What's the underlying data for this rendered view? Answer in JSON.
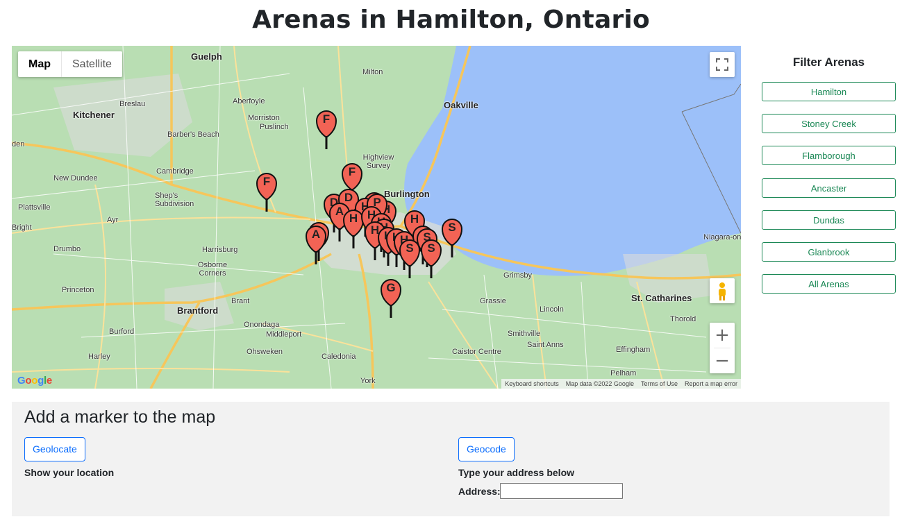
{
  "page": {
    "title": "Arenas in Hamilton, Ontario"
  },
  "map": {
    "type_controls": {
      "map_label": "Map",
      "satellite_label": "Satellite"
    },
    "attribution": {
      "keyboard": "Keyboard shortcuts",
      "data": "Map data ©2022 Google",
      "terms": "Terms of Use",
      "report": "Report a map error"
    },
    "logo": [
      "G",
      "o",
      "o",
      "g",
      "l",
      "e"
    ],
    "places": [
      {
        "name": "Guelph",
        "cls": "city"
      },
      {
        "name": "Kitchener",
        "cls": "city"
      },
      {
        "name": "Oakville",
        "cls": "city"
      },
      {
        "name": "Burlington",
        "cls": "city"
      },
      {
        "name": "Brantford",
        "cls": "city"
      },
      {
        "name": "St. Catharines",
        "cls": "city"
      },
      {
        "name": "Milton",
        "cls": ""
      },
      {
        "name": "Breslau",
        "cls": ""
      },
      {
        "name": "Aberfoyle",
        "cls": ""
      },
      {
        "name": "Morriston",
        "cls": ""
      },
      {
        "name": "Puslinch",
        "cls": ""
      },
      {
        "name": "Barber's Beach",
        "cls": ""
      },
      {
        "name": "Cambridge",
        "cls": ""
      },
      {
        "name": "New Dundee",
        "cls": ""
      },
      {
        "name": "Shep's Subdivision",
        "cls": ""
      },
      {
        "name": "Plattsville",
        "cls": ""
      },
      {
        "name": "Ayr",
        "cls": ""
      },
      {
        "name": "Drumbo",
        "cls": ""
      },
      {
        "name": "Harrisburg",
        "cls": ""
      },
      {
        "name": "Osborne Corners",
        "cls": ""
      },
      {
        "name": "Princeton",
        "cls": ""
      },
      {
        "name": "Brant",
        "cls": ""
      },
      {
        "name": "Burford",
        "cls": ""
      },
      {
        "name": "Onondaga",
        "cls": ""
      },
      {
        "name": "Middleport",
        "cls": ""
      },
      {
        "name": "Ohsweken",
        "cls": ""
      },
      {
        "name": "Caledonia",
        "cls": ""
      },
      {
        "name": "York",
        "cls": ""
      },
      {
        "name": "Harley",
        "cls": ""
      },
      {
        "name": "Grimsby",
        "cls": ""
      },
      {
        "name": "Grassie",
        "cls": ""
      },
      {
        "name": "Lincoln",
        "cls": ""
      },
      {
        "name": "Smithville",
        "cls": ""
      },
      {
        "name": "Saint Anns",
        "cls": ""
      },
      {
        "name": "Caistor Centre",
        "cls": ""
      },
      {
        "name": "Effingham",
        "cls": ""
      },
      {
        "name": "Pelham",
        "cls": ""
      },
      {
        "name": "Thorold",
        "cls": ""
      },
      {
        "name": "Niagara-on",
        "cls": ""
      },
      {
        "name": "Highview Survey",
        "cls": ""
      },
      {
        "name": "Bright",
        "cls": ""
      },
      {
        "name": "den",
        "cls": ""
      }
    ],
    "markers": [
      "F",
      "F",
      "F",
      "D",
      "D",
      "H",
      "H",
      "H",
      "P",
      "A",
      "A",
      "A",
      "H",
      "H",
      "H",
      "H",
      "H",
      "H",
      "H",
      "H",
      "H",
      "S",
      "S",
      "S",
      "S",
      "S",
      "G"
    ]
  },
  "filter": {
    "title": "Filter Arenas",
    "buttons": [
      "Hamilton",
      "Stoney Creek",
      "Flamborough",
      "Ancaster",
      "Dundas",
      "Glanbrook",
      "All Arenas"
    ]
  },
  "panel": {
    "title": "Add a marker to the map",
    "geolocate_label": "Geolocate",
    "geolocate_help": "Show your location",
    "geocode_label": "Geocode",
    "geocode_help": "Type your address below",
    "address_label": "Address:",
    "address_value": ""
  }
}
